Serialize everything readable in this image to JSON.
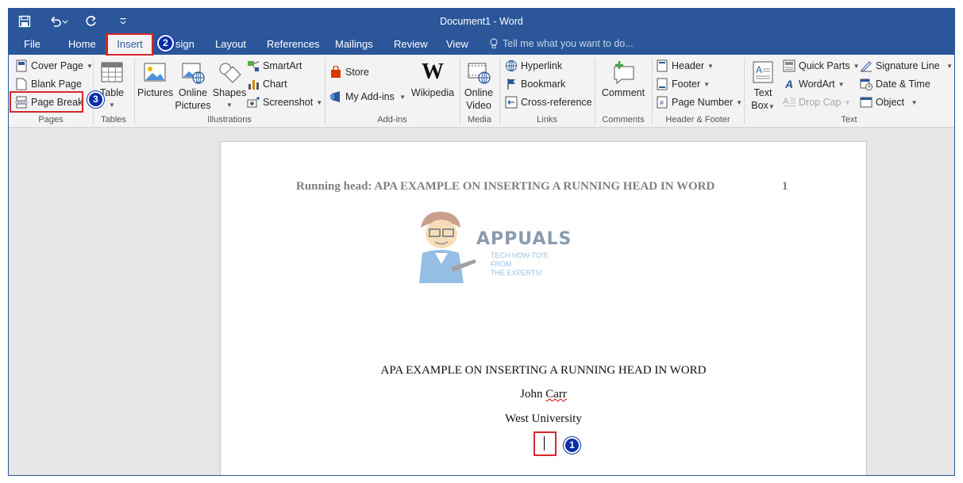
{
  "window": {
    "title": "Document1 - Word"
  },
  "qat": {
    "save_icon": "save-icon",
    "undo_icon": "undo-icon",
    "redo_icon": "redo-icon",
    "customize_icon": "customize-qat-icon"
  },
  "tabs": {
    "file": "File",
    "home": "Home",
    "insert": "Insert",
    "design": "sign",
    "layout": "Layout",
    "references": "References",
    "mailings": "Mailings",
    "review": "Review",
    "view": "View",
    "tellme": "Tell me what you want to do..."
  },
  "ribbon": {
    "pages": {
      "cover_page": "Cover Page",
      "blank_page": "Blank Page",
      "page_break": "Page Break",
      "label": "Pages"
    },
    "tables": {
      "table": "Table",
      "label": "Tables"
    },
    "illustrations": {
      "pictures": "Pictures",
      "online_pictures_1": "Online",
      "online_pictures_2": "Pictures",
      "shapes": "Shapes",
      "smartart": "SmartArt",
      "chart": "Chart",
      "screenshot": "Screenshot",
      "label": "Illustrations"
    },
    "addins": {
      "store": "Store",
      "my_addins": "My Add-ins",
      "wikipedia": "Wikipedia",
      "label": "Add-ins"
    },
    "media": {
      "online_video_1": "Online",
      "online_video_2": "Video",
      "label": "Media"
    },
    "links": {
      "hyperlink": "Hyperlink",
      "bookmark": "Bookmark",
      "cross_reference": "Cross-reference",
      "label": "Links"
    },
    "comments": {
      "comment": "Comment",
      "label": "Comments"
    },
    "header_footer": {
      "header": "Header",
      "footer": "Footer",
      "page_number": "Page Number",
      "label": "Header & Footer"
    },
    "text": {
      "text_box_1": "Text",
      "text_box_2": "Box",
      "quick_parts": "Quick Parts",
      "wordart": "WordArt",
      "drop_cap": "Drop Cap",
      "signature_line": "Signature Line",
      "date_time": "Date & Time",
      "object": "Object",
      "label": "Text"
    }
  },
  "document": {
    "running_head": "Running head: APA EXAMPLE ON INSERTING A RUNNING HEAD IN WORD",
    "page_number": "1",
    "title": "APA EXAMPLE ON INSERTING A RUNNING HEAD IN WORD",
    "author": "John Carr",
    "institution": "West University"
  },
  "watermark": {
    "brand": "APPUALS",
    "tagline_1": "TECH HOW-TO'S FROM",
    "tagline_2": "THE EXPERTS!"
  },
  "annotations": {
    "step1": "1",
    "step2": "2",
    "step3": "3"
  },
  "colors": {
    "word_blue": "#2b579a",
    "annotation_red": "#d9262b",
    "badge_blue": "#0b2fa8"
  }
}
